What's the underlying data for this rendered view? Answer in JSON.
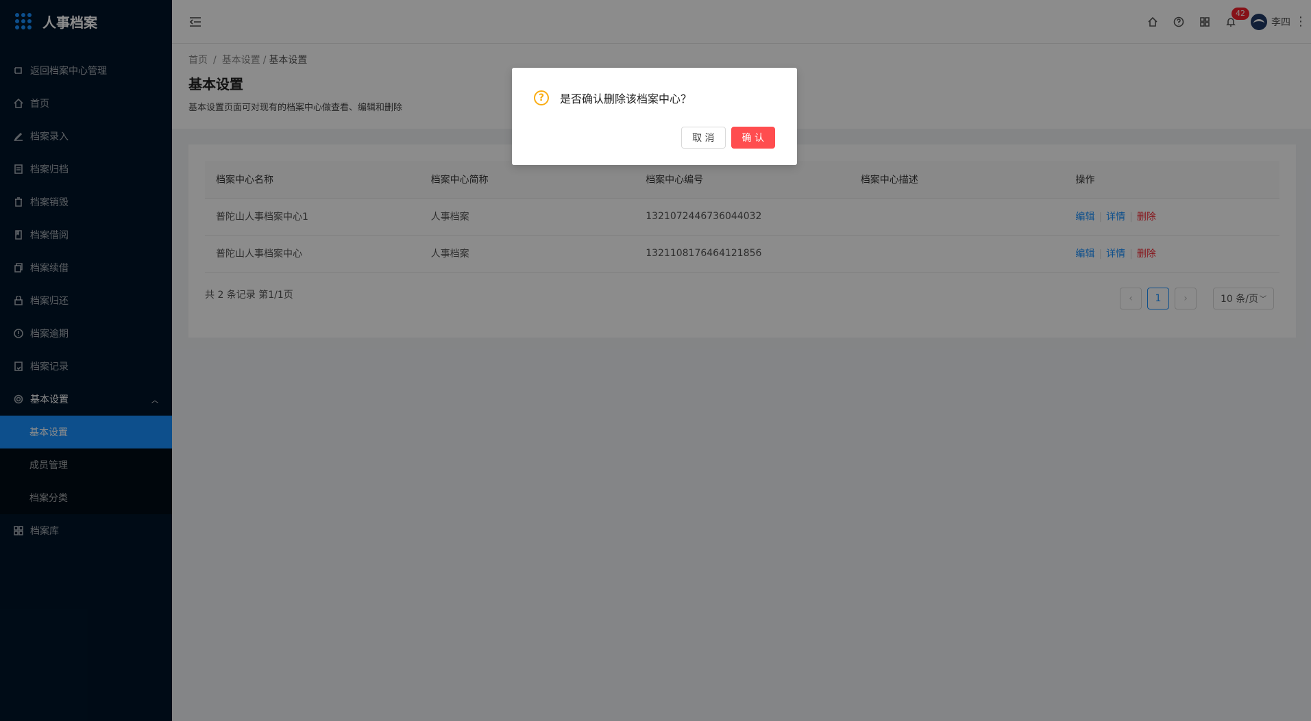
{
  "app": {
    "title": "人事档案"
  },
  "sidebar": {
    "items": [
      {
        "label": "返回档案中心管理",
        "icon": "back-icon"
      },
      {
        "label": "首页",
        "icon": "home-icon"
      },
      {
        "label": "档案录入",
        "icon": "edit-icon"
      },
      {
        "label": "档案归档",
        "icon": "archive-icon"
      },
      {
        "label": "档案销毁",
        "icon": "trash-icon"
      },
      {
        "label": "档案借阅",
        "icon": "book-icon"
      },
      {
        "label": "档案续借",
        "icon": "copy-icon"
      },
      {
        "label": "档案归还",
        "icon": "lock-icon"
      },
      {
        "label": "档案逾期",
        "icon": "alert-icon"
      },
      {
        "label": "档案记录",
        "icon": "record-icon"
      },
      {
        "label": "基本设置",
        "icon": "gear-icon"
      }
    ],
    "sub_items": [
      {
        "label": "基本设置"
      },
      {
        "label": "成员管理"
      },
      {
        "label": "档案分类"
      }
    ],
    "last_item": {
      "label": "档案库",
      "icon": "grid-icon"
    }
  },
  "header": {
    "badge_count": "42",
    "username": "李四"
  },
  "page": {
    "breadcrumb": [
      "首页",
      "基本设置",
      "基本设置"
    ],
    "title": "基本设置",
    "description": "基本设置页面可对现有的档案中心做查看、编辑和删除"
  },
  "table": {
    "columns": [
      "档案中心名称",
      "档案中心简称",
      "档案中心编号",
      "档案中心描述",
      "操作"
    ],
    "rows": [
      {
        "name": "普陀山人事档案中心1",
        "short": "人事档案",
        "code": "1321072446736044032",
        "desc": ""
      },
      {
        "name": "普陀山人事档案中心",
        "short": "人事档案",
        "code": "1321108176464121856",
        "desc": ""
      }
    ],
    "actions": {
      "edit": "编辑",
      "detail": "详情",
      "delete": "删除"
    }
  },
  "pagination": {
    "total_text": "共 2 条记录 第1/1页",
    "current": "1",
    "page_size": "10 条/页"
  },
  "modal": {
    "title": "是否确认删除该档案中心？",
    "cancel": "取 消",
    "confirm": "确 认"
  }
}
